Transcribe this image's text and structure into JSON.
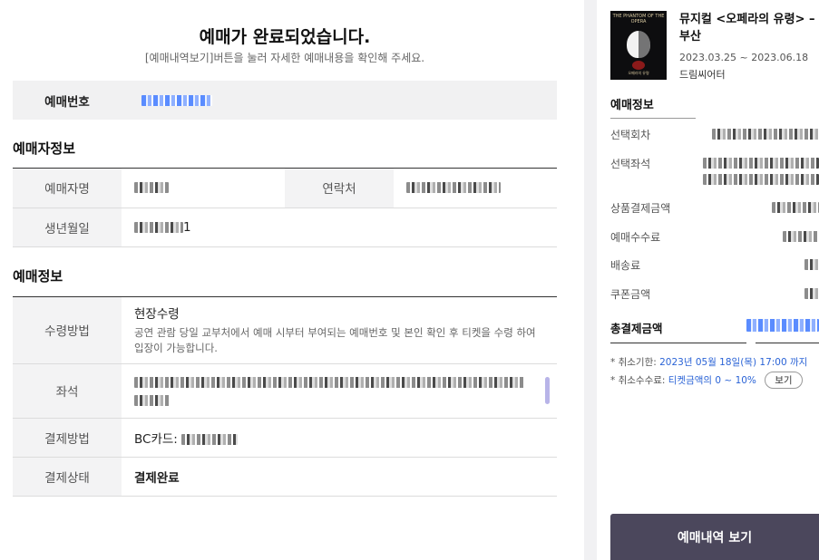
{
  "header": {
    "title": "예매가 완료되었습니다.",
    "subtitle": "[예매내역보기]버튼을 눌러 자세한 예매내용을 확인해 주세요."
  },
  "booking_number": {
    "label": "예매번호"
  },
  "booker": {
    "section_title": "예매자정보",
    "name_label": "예매자명",
    "contact_label": "연락처",
    "birth_label": "생년월일",
    "birth_suffix": "1"
  },
  "reservation": {
    "section_title": "예매정보",
    "pickup_label": "수령방법",
    "pickup_value": "현장수령",
    "pickup_desc": "공연 관람 당일 교부처에서 예매 시부터 부여되는 예매번호 및 본인 확인 후 티켓을 수령 하여 입장이 가능합니다.",
    "seat_label": "좌석",
    "payment_method_label": "결제방법",
    "payment_method_prefix": "BC카드:",
    "payment_status_label": "결제상태",
    "payment_status_value": "결제완료"
  },
  "show": {
    "title": "뮤지컬 <오페라의 유령> – 부산",
    "date_range": "2023.03.25 ~ 2023.06.18",
    "venue": "드림씨어터",
    "poster_text_top": "THE PHANTOM OF THE OPERA",
    "poster_text_bottom": "오페라의 유령"
  },
  "summary": {
    "section_title": "예매정보",
    "rows": [
      {
        "label": "선택회차"
      },
      {
        "label": "선택좌석"
      },
      {
        "label": "상품결제금액"
      },
      {
        "label": "예매수수료"
      },
      {
        "label": "배송료"
      },
      {
        "label": "쿠폰금액"
      }
    ],
    "total_label": "총결제금액",
    "cancel_deadline_label": "* 취소기한:",
    "cancel_deadline_value": "2023년 05월 18일(목) 17:00 까지",
    "cancel_fee_label": "* 취소수수료:",
    "cancel_fee_value": "티켓금액의 0 ~ 10%",
    "view_button": "보기",
    "main_button": "예매내역 보기"
  },
  "colors": {
    "accent_blue": "#2a63d6",
    "button_dark": "#4b475c",
    "scroll_thumb": "#b8b4e8"
  }
}
